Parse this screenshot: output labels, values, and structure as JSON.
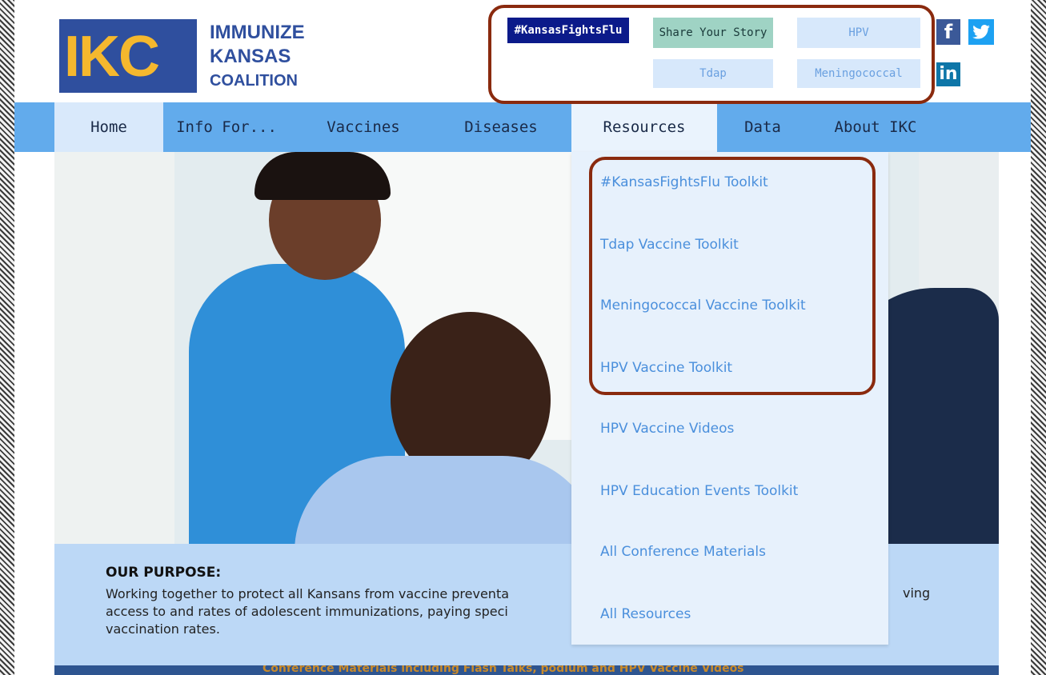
{
  "logo": {
    "mark": "IKC",
    "line1": "IMMUNIZE",
    "line2": "KANSAS",
    "line3": "COALITION"
  },
  "top_buttons": {
    "flu": "#KansasFightsFlu",
    "story": "Share Your Story",
    "hpv": "HPV",
    "tdap": "Tdap",
    "meningococcal": "Meningococcal"
  },
  "social": {
    "facebook": "f",
    "twitter": "t",
    "linkedin": "in"
  },
  "nav": [
    "Home",
    "Info For...",
    "Vaccines",
    "Diseases",
    "Resources",
    "Data",
    "About IKC"
  ],
  "resources_menu": [
    "#KansasFightsFlu Toolkit",
    "Tdap Vaccine Toolkit",
    "Meningococcal Vaccine Toolkit",
    "HPV Vaccine Toolkit",
    "HPV Vaccine Videos",
    "HPV Education Events Toolkit",
    "All Conference Materials",
    "All Resources"
  ],
  "purpose": {
    "title": "OUR PURPOSE:",
    "line1": "Working together to protect all Kansans from vaccine preventa",
    "line1_end": "ving",
    "line2": "access to and rates of adolescent immunizations, paying speci",
    "line3": "vaccination rates."
  },
  "bottom_banner": "Conference Materials including Flash Talks, podium and HPV Vaccine Videos"
}
